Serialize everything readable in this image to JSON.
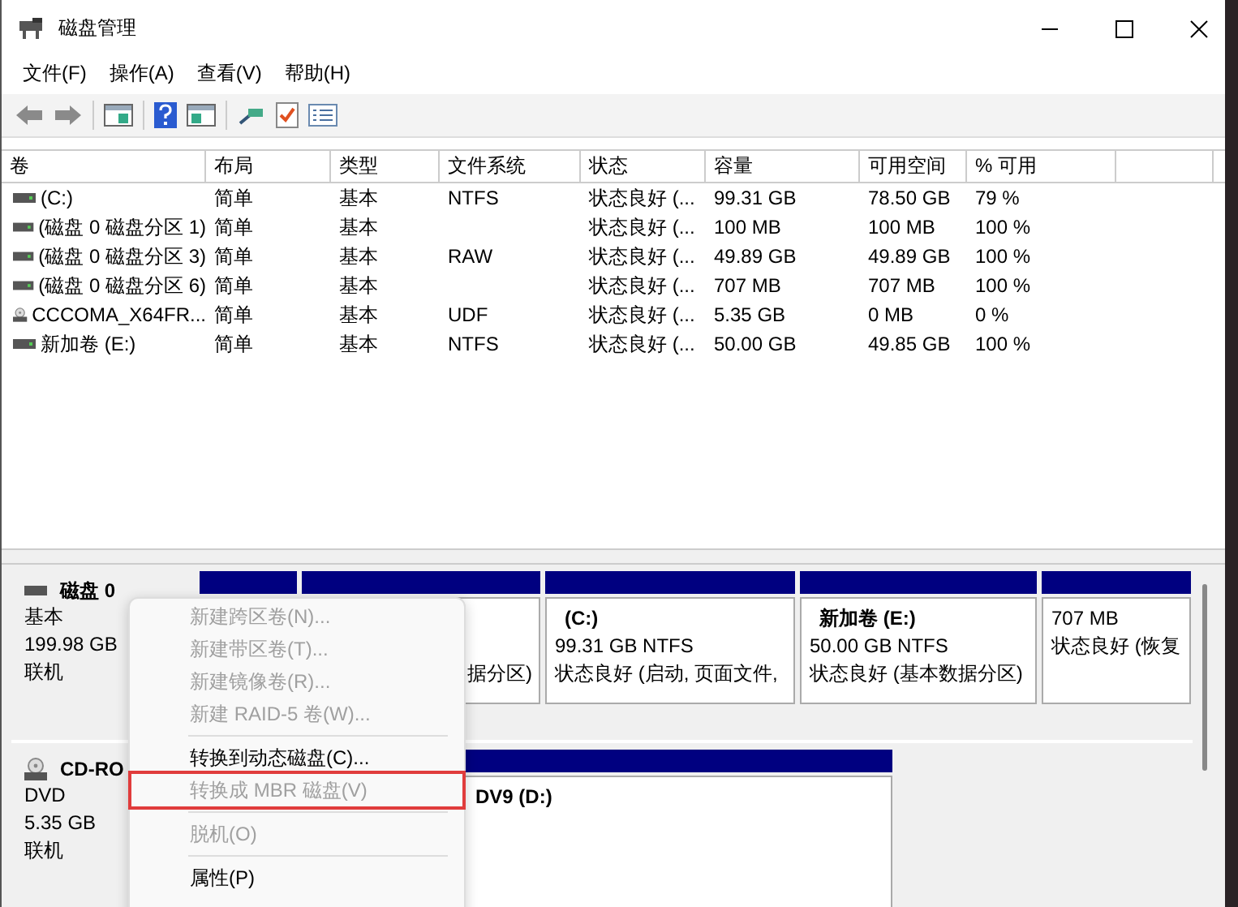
{
  "window": {
    "title": "磁盘管理"
  },
  "menu": [
    "文件(F)",
    "操作(A)",
    "查看(V)",
    "帮助(H)"
  ],
  "table": {
    "columns": [
      "卷",
      "布局",
      "类型",
      "文件系统",
      "状态",
      "容量",
      "可用空间",
      "% 可用"
    ],
    "rows": [
      {
        "kind": "disk",
        "cells": [
          "(C:)",
          "简单",
          "基本",
          "NTFS",
          "状态良好 (...",
          "99.31 GB",
          "78.50 GB",
          "79 %"
        ]
      },
      {
        "kind": "disk",
        "cells": [
          "(磁盘 0 磁盘分区 1)",
          "简单",
          "基本",
          "",
          "状态良好 (...",
          "100 MB",
          "100 MB",
          "100 %"
        ]
      },
      {
        "kind": "disk",
        "cells": [
          "(磁盘 0 磁盘分区 3)",
          "简单",
          "基本",
          "RAW",
          "状态良好 (...",
          "49.89 GB",
          "49.89 GB",
          "100 %"
        ]
      },
      {
        "kind": "disk",
        "cells": [
          "(磁盘 0 磁盘分区 6)",
          "简单",
          "基本",
          "",
          "状态良好 (...",
          "707 MB",
          "707 MB",
          "100 %"
        ]
      },
      {
        "kind": "cd",
        "cells": [
          "CCCOMA_X64FR...",
          "简单",
          "基本",
          "UDF",
          "状态良好 (...",
          "5.35 GB",
          "0 MB",
          "0 %"
        ]
      },
      {
        "kind": "disk",
        "cells": [
          "新加卷 (E:)",
          "简单",
          "基本",
          "NTFS",
          "状态良好 (...",
          "50.00 GB",
          "49.85 GB",
          "100 %"
        ]
      }
    ]
  },
  "disks": [
    {
      "kind": "disk",
      "name": "磁盘 0",
      "lines": [
        "基本",
        "199.98 GB",
        "联机"
      ],
      "partitions": [
        {
          "lines": [
            "据分区)"
          ]
        },
        {
          "name": "(C:)",
          "lines": [
            "99.31 GB NTFS",
            "状态良好 (启动, 页面文件,"
          ]
        },
        {
          "name": "新加卷  (E:)",
          "lines": [
            "50.00 GB NTFS",
            "状态良好 (基本数据分区)"
          ]
        },
        {
          "lines": [
            "707 MB",
            "状态良好 (恢复"
          ]
        }
      ]
    },
    {
      "kind": "cd",
      "name": "CD-RO",
      "lines": [
        "DVD",
        "5.35 GB",
        "联机"
      ],
      "partitions": [
        {
          "name": "DV9  (D:)"
        }
      ]
    }
  ],
  "context_menu": [
    {
      "kind": "item",
      "label": "新建跨区卷(N)...",
      "disabled": true,
      "highlighted": false
    },
    {
      "kind": "item",
      "label": "新建带区卷(T)...",
      "disabled": true,
      "highlighted": false
    },
    {
      "kind": "item",
      "label": "新建镜像卷(R)...",
      "disabled": true,
      "highlighted": false
    },
    {
      "kind": "item",
      "label": "新建 RAID-5 卷(W)...",
      "disabled": true,
      "highlighted": false
    },
    {
      "kind": "separator"
    },
    {
      "kind": "item",
      "label": "转换到动态磁盘(C)...",
      "disabled": false,
      "highlighted": false
    },
    {
      "kind": "item",
      "label": "转换成 MBR 磁盘(V)",
      "disabled": true,
      "highlighted": true
    },
    {
      "kind": "separator"
    },
    {
      "kind": "item",
      "label": "脱机(O)",
      "disabled": true,
      "highlighted": false
    },
    {
      "kind": "separator"
    },
    {
      "kind": "item",
      "label": "属性(P)",
      "disabled": false,
      "highlighted": false
    }
  ]
}
